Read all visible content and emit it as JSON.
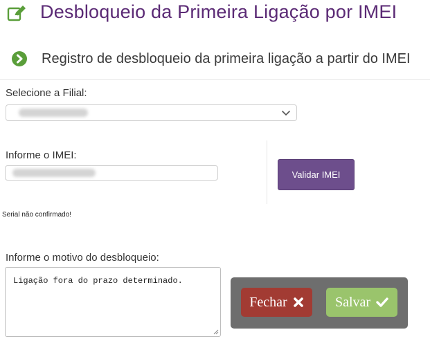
{
  "header": {
    "title": "Desbloqueio da Primeira Ligação por IMEI",
    "title_icon": "edit-icon",
    "subtitle": "Registro de desbloqueio da primeira ligação a partir do IMEI",
    "subtitle_icon": "chevron-right-circle-icon"
  },
  "form": {
    "filial_label": "Selecione a Filial:",
    "filial_value": "",
    "imei_label": "Informe o IMEI:",
    "imei_value": "",
    "validar_label": "Validar IMEI",
    "serial_status": "Serial não confirmado!",
    "motivo_label": "Informe o motivo do desbloqueio:",
    "motivo_value": "Ligação fora do prazo determinado."
  },
  "actions": {
    "fechar_label": "Fechar",
    "fechar_icon": "close-icon",
    "salvar_label": "Salvar",
    "salvar_icon": "check-icon"
  },
  "colors": {
    "title": "#5b2a75",
    "validar_button": "#6d4e8c",
    "fechar_button": "#a23b33",
    "salvar_button": "#9ac46c",
    "panel": "#6e6e6e",
    "subtitle_icon": "#5a9e3a"
  }
}
